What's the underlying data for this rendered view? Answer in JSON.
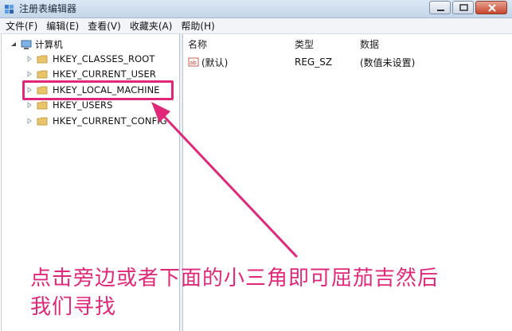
{
  "window": {
    "title": "注册表编辑器"
  },
  "menu": [
    "文件(F)",
    "编辑(E)",
    "查看(V)",
    "收藏夹(A)",
    "帮助(H)"
  ],
  "tree": {
    "root": "计算机",
    "keys": [
      "HKEY_CLASSES_ROOT",
      "HKEY_CURRENT_USER",
      "HKEY_LOCAL_MACHINE",
      "HKEY_USERS",
      "HKEY_CURRENT_CONFIG"
    ],
    "highlighted": "HKEY_LOCAL_MACHINE"
  },
  "list": {
    "columns": [
      "名称",
      "类型",
      "数据"
    ],
    "rows": [
      {
        "name": "(默认)",
        "type": "REG_SZ",
        "data": "(数值未设置)"
      }
    ]
  },
  "annotation": {
    "line1": "点击旁边或者下面的小三角即可屈茄吉然后",
    "line2": "我们寻找",
    "color": "#e0287a"
  },
  "colors": {
    "accent": "#e0287a",
    "folder": "#e9c46a"
  },
  "icons": [
    "regedit-icon",
    "computer-icon",
    "folder-icon",
    "expand-arrow-icon",
    "string-value-icon",
    "minimize-icon",
    "maximize-icon",
    "close-icon"
  ]
}
